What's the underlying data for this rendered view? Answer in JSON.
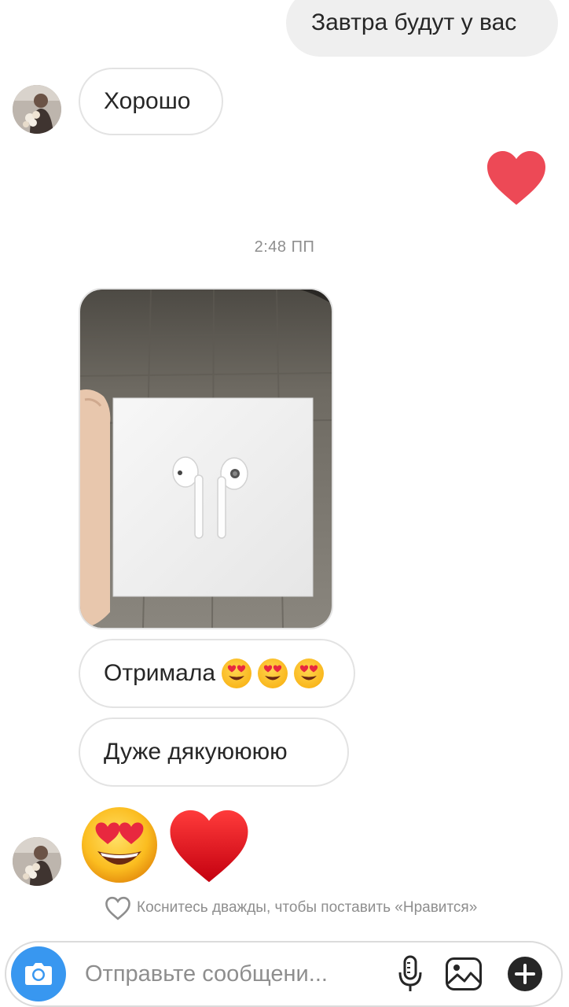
{
  "messages": {
    "m1_text": "Завтра будут у вас",
    "m2_text": "Хорошо",
    "m3_reaction": "heart",
    "timestamp": "2:48 ПП",
    "photo_alt": "AirPods box photo",
    "m5_text": "Отримала",
    "m6_text": "Дуже дякуюююю",
    "m7_emojis": [
      "heart-eyes-emoji",
      "red-heart-emoji"
    ]
  },
  "like_hint": {
    "text": "Коснитесь дважды, чтобы поставить «Нравится»"
  },
  "composer": {
    "placeholder": "Отправьте сообщени..."
  },
  "colors": {
    "accent": "#3897f0",
    "heart": "#ed4956",
    "outgoing_bubble": "#efefef",
    "muted_text": "#8e8e8e"
  }
}
